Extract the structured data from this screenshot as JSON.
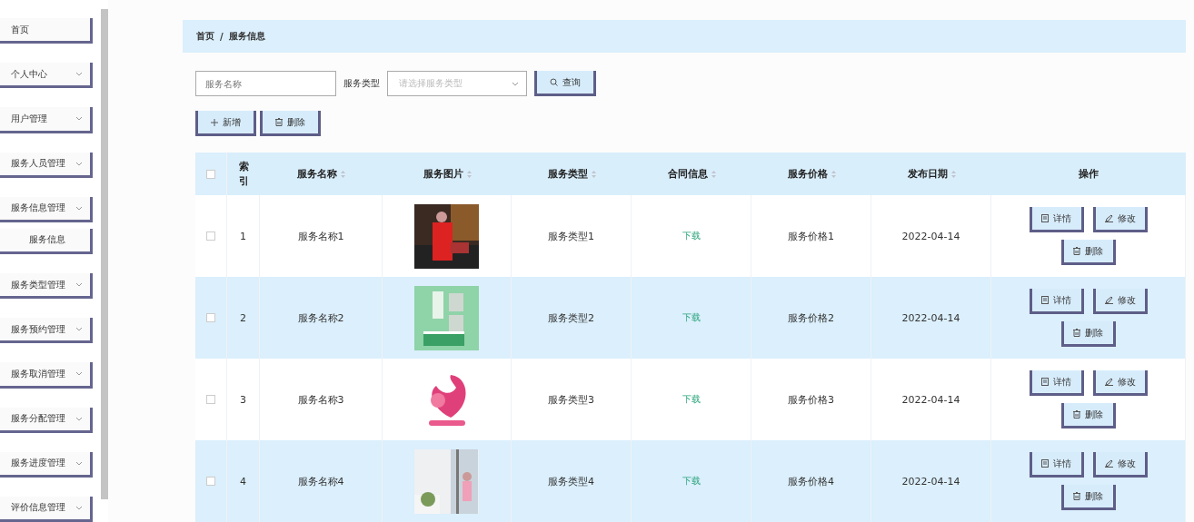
{
  "sidebar": {
    "items": [
      {
        "label": "首页",
        "has_children": false,
        "sub": false
      },
      {
        "label": "个人中心",
        "has_children": true,
        "sub": false
      },
      {
        "label": "用户管理",
        "has_children": true,
        "sub": false
      },
      {
        "label": "服务人员管理",
        "has_children": true,
        "sub": false
      },
      {
        "label": "服务信息管理",
        "has_children": true,
        "sub": false
      },
      {
        "label": "服务信息",
        "has_children": false,
        "sub": true
      },
      {
        "label": "服务类型管理",
        "has_children": true,
        "sub": false
      },
      {
        "label": "服务预约管理",
        "has_children": true,
        "sub": false
      },
      {
        "label": "服务取消管理",
        "has_children": true,
        "sub": false
      },
      {
        "label": "服务分配管理",
        "has_children": true,
        "sub": false
      },
      {
        "label": "服务进度管理",
        "has_children": true,
        "sub": false
      },
      {
        "label": "评价信息管理",
        "has_children": true,
        "sub": false
      }
    ]
  },
  "breadcrumb": [
    "首页",
    "/",
    "服务信息"
  ],
  "search": {
    "name_placeholder": "服务名称",
    "type_label": "服务类型",
    "type_placeholder": "请选择服务类型",
    "query_button": "查询"
  },
  "actions": [
    "新增",
    "删除"
  ],
  "table": {
    "all_checked": false,
    "columns": [
      {
        "label": "索引",
        "sortable": false
      },
      {
        "label": "服务名称",
        "sortable": true
      },
      {
        "label": "服务图片",
        "sortable": true
      },
      {
        "label": "服务类型",
        "sortable": true
      },
      {
        "label": "合同信息",
        "sortable": true
      },
      {
        "label": "服务价格",
        "sortable": true
      },
      {
        "label": "发布日期",
        "sortable": true
      },
      {
        "label": "操作",
        "sortable": false
      }
    ],
    "rows": [
      {
        "checked": false,
        "index": "1",
        "name": "服务名称1",
        "picture": {
          "kind": "picture"
        },
        "type": "服务类型1",
        "contract": "下载",
        "price": "服务价格1",
        "date": "2022-04-14",
        "ops": [
          "详情",
          "修改",
          "删除"
        ]
      },
      {
        "checked": false,
        "index": "2",
        "name": "服务名称2",
        "picture": {
          "kind": "picture"
        },
        "type": "服务类型2",
        "contract": "下载",
        "price": "服务价格2",
        "date": "2022-04-14",
        "ops": [
          "详情",
          "修改",
          "删除"
        ]
      },
      {
        "checked": false,
        "index": "3",
        "name": "服务名称3",
        "picture": {
          "kind": "picture"
        },
        "type": "服务类型3",
        "contract": "下载",
        "price": "服务价格3",
        "date": "2022-04-14",
        "ops": [
          "详情",
          "修改",
          "删除"
        ]
      },
      {
        "checked": false,
        "index": "4",
        "name": "服务名称4",
        "picture": {
          "kind": "picture"
        },
        "type": "服务类型4",
        "contract": "下载",
        "price": "服务价格4",
        "date": "2022-04-14",
        "ops": [
          "详情",
          "修改",
          "删除"
        ]
      }
    ]
  }
}
